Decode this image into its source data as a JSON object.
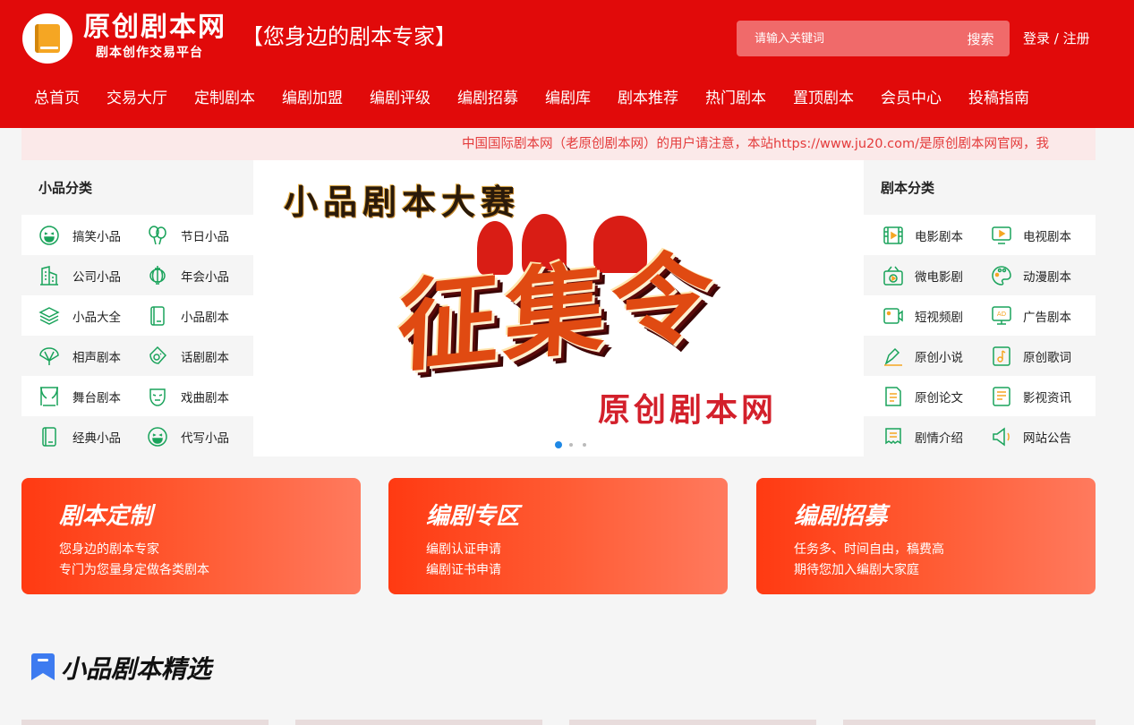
{
  "header": {
    "logo_title": "原创剧本网",
    "logo_subtitle": "剧本创作交易平台",
    "slogan": "【您身边的剧本专家】",
    "search_placeholder": "请输入关键词",
    "search_button": "搜索",
    "login": "登录",
    "separator": "/",
    "register": "注册",
    "brand_color": "#e10a0a"
  },
  "nav": [
    {
      "label": "总首页"
    },
    {
      "label": "交易大厅"
    },
    {
      "label": "定制剧本"
    },
    {
      "label": "编剧加盟"
    },
    {
      "label": "编剧评级"
    },
    {
      "label": "编剧招募"
    },
    {
      "label": "编剧库"
    },
    {
      "label": "剧本推荐"
    },
    {
      "label": "热门剧本"
    },
    {
      "label": "置顶剧本"
    },
    {
      "label": "会员中心"
    },
    {
      "label": "投稿指南"
    }
  ],
  "notice": "中国国际剧本网（老原创剧本网）的用户请注意，本站https://www.ju20.com/是原创剧本网官网，我",
  "left_panel": {
    "title": "小品分类",
    "items": [
      {
        "label": "搞笑小品",
        "icon": "laugh-face-icon"
      },
      {
        "label": "节日小品",
        "icon": "balloons-icon"
      },
      {
        "label": "公司小品",
        "icon": "building-icon"
      },
      {
        "label": "年会小品",
        "icon": "lantern-icon"
      },
      {
        "label": "小品大全",
        "icon": "layers-icon"
      },
      {
        "label": "小品剧本",
        "icon": "book-icon"
      },
      {
        "label": "相声剧本",
        "icon": "fan-icon"
      },
      {
        "label": "话剧剧本",
        "icon": "theater-mask-icon"
      },
      {
        "label": "舞台剧本",
        "icon": "stage-curtain-icon"
      },
      {
        "label": "戏曲剧本",
        "icon": "opera-mask-icon"
      },
      {
        "label": "经典小品",
        "icon": "book-classic-icon"
      },
      {
        "label": "代写小品",
        "icon": "grin-face-icon"
      }
    ]
  },
  "right_panel": {
    "title": "剧本分类",
    "items": [
      {
        "label": "电影剧本",
        "icon": "film-icon"
      },
      {
        "label": "电视剧本",
        "icon": "tv-icon"
      },
      {
        "label": "微电影剧",
        "icon": "projector-icon"
      },
      {
        "label": "动漫剧本",
        "icon": "palette-icon"
      },
      {
        "label": "短视频剧",
        "icon": "video-camera-icon"
      },
      {
        "label": "广告剧本",
        "icon": "ad-screen-icon"
      },
      {
        "label": "原创小说",
        "icon": "pen-icon"
      },
      {
        "label": "原创歌词",
        "icon": "music-note-icon"
      },
      {
        "label": "原创论文",
        "icon": "document-icon"
      },
      {
        "label": "影视资讯",
        "icon": "news-icon"
      },
      {
        "label": "剧情介绍",
        "icon": "scroll-icon"
      },
      {
        "label": "网站公告",
        "icon": "megaphone-icon"
      }
    ]
  },
  "banner": {
    "headline": "小品剧本大赛",
    "main_text": "征集令",
    "brand": "原创剧本网",
    "slides": 3,
    "active_slide": 1
  },
  "cards": [
    {
      "title": "剧本定制",
      "line1": "您身边的剧本专家",
      "line2": "专门为您量身定做各类剧本"
    },
    {
      "title": "编剧专区",
      "line1": "编剧认证申请",
      "line2": "编剧证书申请"
    },
    {
      "title": "编剧招募",
      "line1": "任务多、时间自由，稿费高",
      "line2": "期待您加入编剧大家庭"
    }
  ],
  "section": {
    "title": "小品剧本精选",
    "icon": "bookmark-icon"
  },
  "colors": {
    "accent_green": "#1aa35b",
    "card_gradient_start": "#ff3a12",
    "card_gradient_end": "#ff7a5e",
    "notice_text": "#e43b3b"
  }
}
